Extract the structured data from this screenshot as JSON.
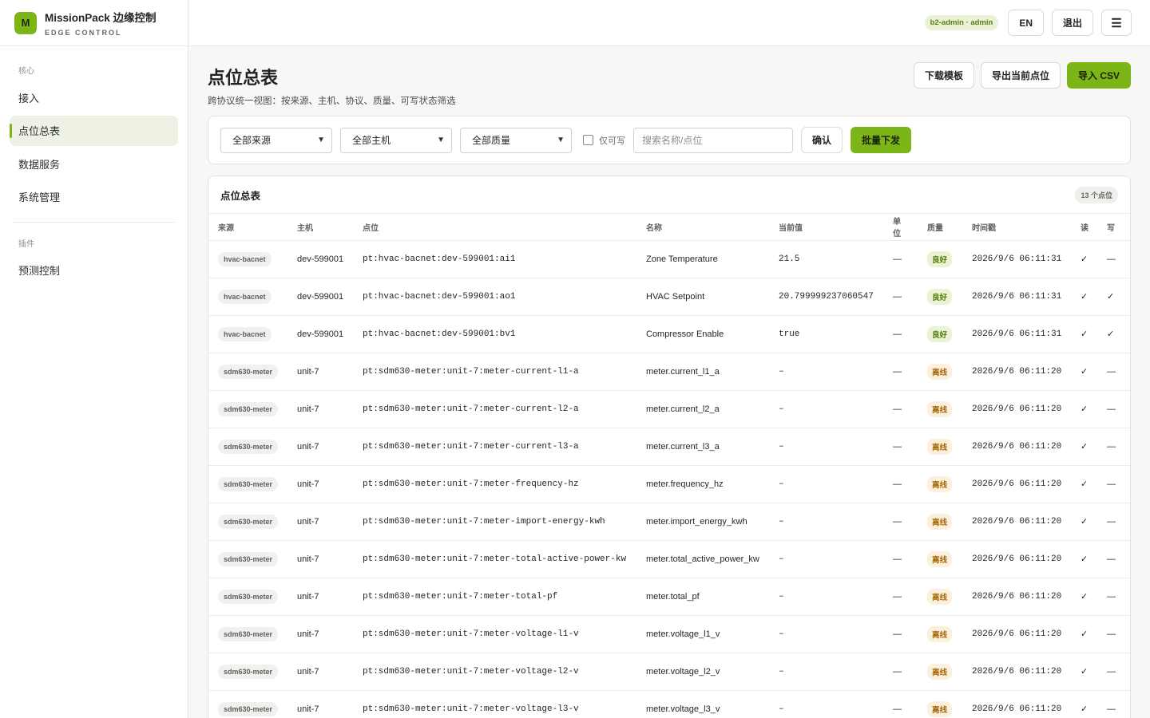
{
  "brand": {
    "logo_letter": "M",
    "title": "MissionPack 边缘控制",
    "subtitle": "EDGE CONTROL"
  },
  "sidebar": {
    "section_core": "核心",
    "items": [
      {
        "label": "接入",
        "active": false
      },
      {
        "label": "点位总表",
        "active": true
      },
      {
        "label": "数据服务",
        "active": false
      },
      {
        "label": "系统管理",
        "active": false
      }
    ],
    "section_plugins": "插件",
    "plugin_items": [
      {
        "label": "预测控制"
      }
    ]
  },
  "topbar": {
    "user": "b2-admin · admin",
    "lang": "EN",
    "logout": "退出",
    "menu_icon": "hamburger-menu-icon"
  },
  "page": {
    "title": "点位总表",
    "description": "跨协议统一视图：按来源、主机、协议、质量、可写状态筛选",
    "actions": {
      "download_template": "下载模板",
      "export_current": "导出当前点位",
      "import_csv": "导入 CSV"
    }
  },
  "filters": {
    "source": "全部来源",
    "host": "全部主机",
    "quality": "全部质量",
    "writable_only": "仅可写",
    "search_placeholder": "搜索名称/点位",
    "confirm": "确认",
    "batch_send": "批量下发"
  },
  "table": {
    "title": "点位总表",
    "count": "13 个点位",
    "columns": {
      "source": "来源",
      "host": "主机",
      "point": "点位",
      "name": "名称",
      "value": "当前值",
      "unit": "单位",
      "quality": "质量",
      "timestamp": "时间戳",
      "read": "读",
      "write": "写"
    },
    "rows": [
      {
        "source": "hvac-bacnet",
        "host": "dev-599001",
        "point": "pt:hvac-bacnet:dev-599001:ai1",
        "name": "Zone Temperature",
        "value": "21.5",
        "unit": "—",
        "quality": "良好",
        "quality_status": "good",
        "timestamp": "2026/9/6 06:11:31",
        "read": "✓",
        "write": "—"
      },
      {
        "source": "hvac-bacnet",
        "host": "dev-599001",
        "point": "pt:hvac-bacnet:dev-599001:ao1",
        "name": "HVAC Setpoint",
        "value": "20.799999237060547",
        "unit": "—",
        "quality": "良好",
        "quality_status": "good",
        "timestamp": "2026/9/6 06:11:31",
        "read": "✓",
        "write": "✓"
      },
      {
        "source": "hvac-bacnet",
        "host": "dev-599001",
        "point": "pt:hvac-bacnet:dev-599001:bv1",
        "name": "Compressor Enable",
        "value": "true",
        "unit": "—",
        "quality": "良好",
        "quality_status": "good",
        "timestamp": "2026/9/6 06:11:31",
        "read": "✓",
        "write": "✓"
      },
      {
        "source": "sdm630-meter",
        "host": "unit-7",
        "point": "pt:sdm630-meter:unit-7:meter-current-l1-a",
        "name": "meter.current_l1_a",
        "value": "–",
        "unit": "—",
        "quality": "离线",
        "quality_status": "offline",
        "timestamp": "2026/9/6 06:11:20",
        "read": "✓",
        "write": "—"
      },
      {
        "source": "sdm630-meter",
        "host": "unit-7",
        "point": "pt:sdm630-meter:unit-7:meter-current-l2-a",
        "name": "meter.current_l2_a",
        "value": "–",
        "unit": "—",
        "quality": "离线",
        "quality_status": "offline",
        "timestamp": "2026/9/6 06:11:20",
        "read": "✓",
        "write": "—"
      },
      {
        "source": "sdm630-meter",
        "host": "unit-7",
        "point": "pt:sdm630-meter:unit-7:meter-current-l3-a",
        "name": "meter.current_l3_a",
        "value": "–",
        "unit": "—",
        "quality": "离线",
        "quality_status": "offline",
        "timestamp": "2026/9/6 06:11:20",
        "read": "✓",
        "write": "—"
      },
      {
        "source": "sdm630-meter",
        "host": "unit-7",
        "point": "pt:sdm630-meter:unit-7:meter-frequency-hz",
        "name": "meter.frequency_hz",
        "value": "–",
        "unit": "—",
        "quality": "离线",
        "quality_status": "offline",
        "timestamp": "2026/9/6 06:11:20",
        "read": "✓",
        "write": "—"
      },
      {
        "source": "sdm630-meter",
        "host": "unit-7",
        "point": "pt:sdm630-meter:unit-7:meter-import-energy-kwh",
        "name": "meter.import_energy_kwh",
        "value": "–",
        "unit": "—",
        "quality": "离线",
        "quality_status": "offline",
        "timestamp": "2026/9/6 06:11:20",
        "read": "✓",
        "write": "—"
      },
      {
        "source": "sdm630-meter",
        "host": "unit-7",
        "point": "pt:sdm630-meter:unit-7:meter-total-active-power-kw",
        "name": "meter.total_active_power_kw",
        "value": "–",
        "unit": "—",
        "quality": "离线",
        "quality_status": "offline",
        "timestamp": "2026/9/6 06:11:20",
        "read": "✓",
        "write": "—"
      },
      {
        "source": "sdm630-meter",
        "host": "unit-7",
        "point": "pt:sdm630-meter:unit-7:meter-total-pf",
        "name": "meter.total_pf",
        "value": "–",
        "unit": "—",
        "quality": "离线",
        "quality_status": "offline",
        "timestamp": "2026/9/6 06:11:20",
        "read": "✓",
        "write": "—"
      },
      {
        "source": "sdm630-meter",
        "host": "unit-7",
        "point": "pt:sdm630-meter:unit-7:meter-voltage-l1-v",
        "name": "meter.voltage_l1_v",
        "value": "–",
        "unit": "—",
        "quality": "离线",
        "quality_status": "offline",
        "timestamp": "2026/9/6 06:11:20",
        "read": "✓",
        "write": "—"
      },
      {
        "source": "sdm630-meter",
        "host": "unit-7",
        "point": "pt:sdm630-meter:unit-7:meter-voltage-l2-v",
        "name": "meter.voltage_l2_v",
        "value": "–",
        "unit": "—",
        "quality": "离线",
        "quality_status": "offline",
        "timestamp": "2026/9/6 06:11:20",
        "read": "✓",
        "write": "—"
      },
      {
        "source": "sdm630-meter",
        "host": "unit-7",
        "point": "pt:sdm630-meter:unit-7:meter-voltage-l3-v",
        "name": "meter.voltage_l3_v",
        "value": "–",
        "unit": "—",
        "quality": "离线",
        "quality_status": "offline",
        "timestamp": "2026/9/6 06:11:20",
        "read": "✓",
        "write": "—"
      }
    ]
  },
  "colors": {
    "accent": "#7cb518",
    "good_bg": "#eaf4d4",
    "good_fg": "#4f7a0b",
    "offline_bg": "#fbf0dc",
    "offline_fg": "#a86a0c"
  }
}
